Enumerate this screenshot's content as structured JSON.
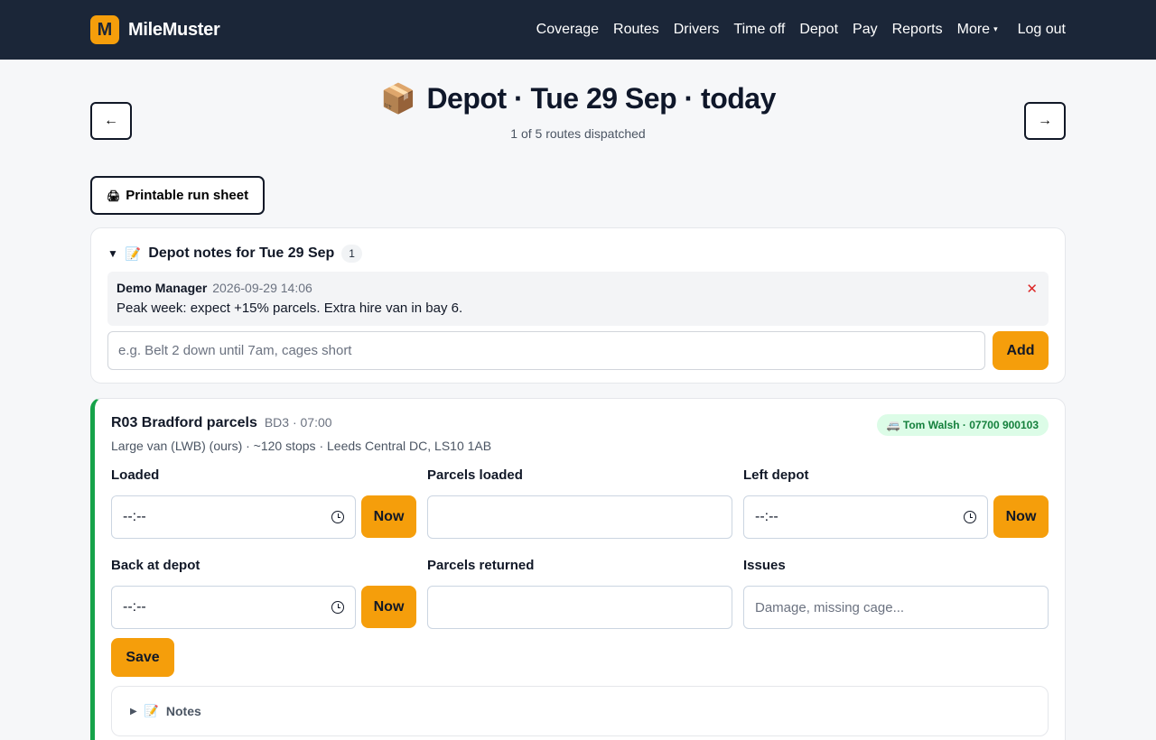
{
  "app": {
    "logo_letter": "M",
    "name": "MileMuster"
  },
  "nav": {
    "links": [
      "Coverage",
      "Routes",
      "Drivers",
      "Time off",
      "Depot",
      "Pay",
      "Reports",
      "More"
    ],
    "more_caret": "▾",
    "logout": "Log out"
  },
  "header": {
    "prev": "←",
    "next": "→",
    "icon": "📦",
    "title": "Depot · Tue 29 Sep · today",
    "subtitle": "1 of 5 routes dispatched"
  },
  "run_sheet": {
    "icon": "🖨",
    "label": "Printable run sheet"
  },
  "depot_notes": {
    "toggle": "▼",
    "icon": "📝",
    "title": "Depot notes for Tue 29 Sep",
    "count": "1",
    "notes": [
      {
        "author": "Demo Manager",
        "time": "2026-09-29 14:06",
        "text": "Peak week: expect +15% parcels. Extra hire van in bay 6.",
        "delete": "✕"
      }
    ],
    "input_placeholder": "e.g. Belt 2 down until 7am, cages short",
    "add_label": "Add"
  },
  "route": {
    "name": "R03 Bradford parcels",
    "code": "BD3 · 07:00",
    "details": "Large van (LWB) (ours) · ~120 stops · Leeds Central DC, LS10 1AB",
    "driver": "🚐 Tom Walsh · 07700 900103",
    "status_color": "#16a34a",
    "fields": {
      "loaded": {
        "label": "Loaded",
        "value": "--:--",
        "now": "Now"
      },
      "parcels_loaded": {
        "label": "Parcels loaded",
        "value": ""
      },
      "left_depot": {
        "label": "Left depot",
        "value": "--:--",
        "now": "Now"
      },
      "back_at_depot": {
        "label": "Back at depot",
        "value": "--:--",
        "now": "Now"
      },
      "parcels_returned": {
        "label": "Parcels returned",
        "value": ""
      },
      "issues": {
        "label": "Issues",
        "placeholder": "Damage, missing cage..."
      }
    },
    "save_label": "Save",
    "notes_toggle": "▶",
    "notes_icon": "📝",
    "notes_label": "Notes"
  },
  "colors": {
    "nav_bg": "#1b2638",
    "accent": "#f59e0b",
    "success": "#16a34a"
  }
}
